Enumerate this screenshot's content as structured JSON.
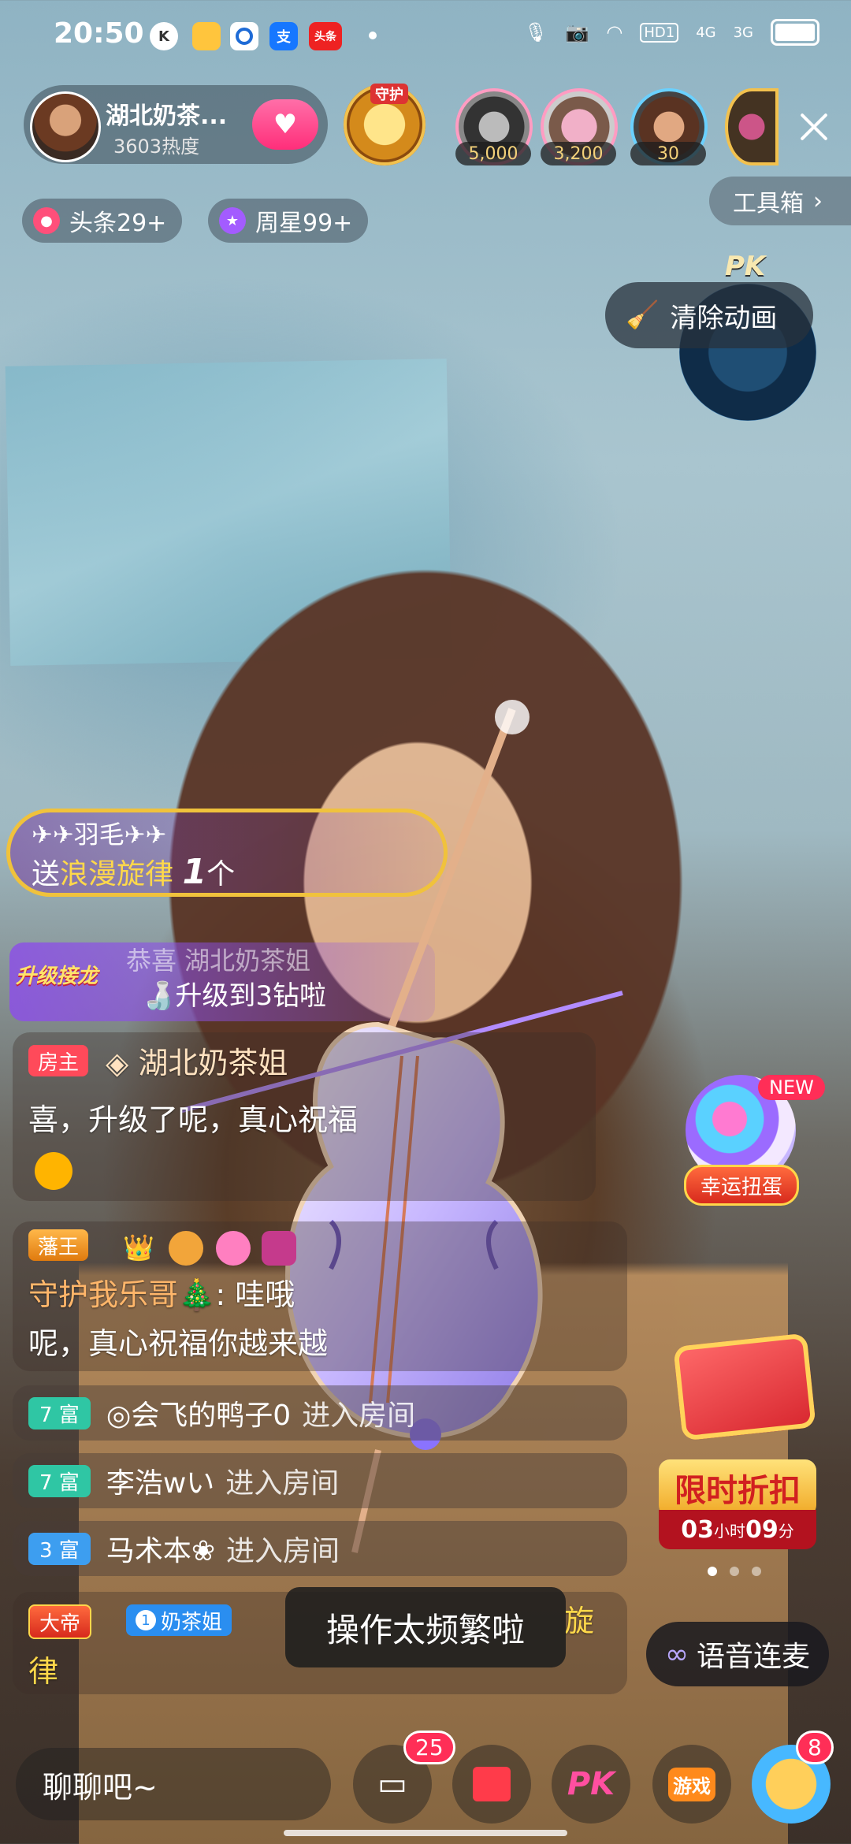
{
  "status_bar": {
    "time": "20:50",
    "apps": [
      "K",
      "支",
      "头条"
    ],
    "network": [
      "HD1",
      "4G",
      "3G"
    ]
  },
  "host": {
    "name": "湖北奶茶...",
    "heat": "3603热度",
    "guard_label": "守护"
  },
  "viewers": [
    {
      "count": "5,000"
    },
    {
      "count": "3,200"
    },
    {
      "count": "30"
    }
  ],
  "pills": {
    "headline": "头条29+",
    "weekly_star": "周星99+"
  },
  "toolbox_label": "工具箱",
  "pk_label": "PK",
  "clear_animation_label": "清除动画",
  "gift_banner": {
    "sender": "✈✈羽毛✈✈",
    "prefix": "送",
    "gift_name": "浪漫旋律",
    "count": "1",
    "unit": "个"
  },
  "upgrade": {
    "badge": "升级接龙",
    "line1": "恭喜 湖北奶茶姐",
    "line2": "升级到3钻啦"
  },
  "chat": [
    {
      "tag": "房主",
      "user": "湖北奶茶姐",
      "text": "喜，升级了呢，真心祝福"
    },
    {
      "tag": "藩王",
      "user": "守护我乐哥🎄",
      "text_line1": ": 哇哦",
      "text_line2": "呢，真心祝福你越来越"
    }
  ],
  "enter_rows": [
    {
      "level": "7 富",
      "user": "◎会飞的鸭子0",
      "action": "进入房间"
    },
    {
      "level": "7 富",
      "user": "李浩wい",
      "action": "进入房间"
    },
    {
      "level": "3 富",
      "user": "马术本❀",
      "action": "进入房间"
    }
  ],
  "last_chat": {
    "tag": "大帝",
    "fan_badge": "奶茶姐",
    "fan_level": "1",
    "text_tail": "旋",
    "line2": "律"
  },
  "toast": "操作太频繁啦",
  "lucky": {
    "new_badge": "NEW",
    "label": "幸运扭蛋"
  },
  "sale": {
    "label": "限时折扣",
    "hours": "03",
    "hours_unit": "小时",
    "minutes": "09",
    "minutes_unit": "分"
  },
  "voice_mic_label": "语音连麦",
  "bottom": {
    "chat_placeholder": "聊聊吧~",
    "message_badge": "25",
    "pk_label": "PK",
    "game_label": "游戏",
    "more_badge": "8"
  }
}
